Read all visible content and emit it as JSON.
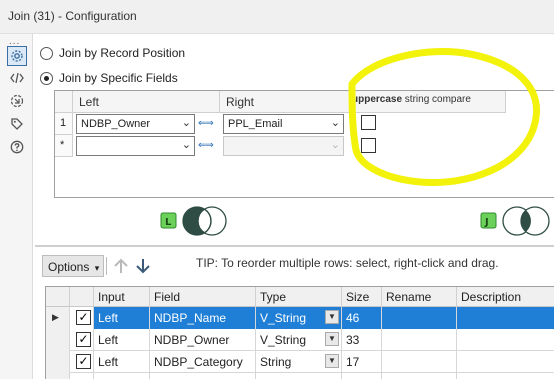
{
  "window": {
    "title": "Join (31) - Configuration"
  },
  "rail": {
    "dots": "...",
    "icons": [
      "gear-icon",
      "code-icon",
      "workflow-icon",
      "tag-icon",
      "help-icon"
    ]
  },
  "join_mode": {
    "options": [
      {
        "label": "Join by Record Position",
        "selected": false
      },
      {
        "label": "Join by Specific Fields",
        "selected": true
      }
    ]
  },
  "fields_grid": {
    "left_header": "Left",
    "right_header": "Right",
    "compare_header": "uppercase string compare",
    "compare_header_bold": "uppercase",
    "compare_header_rest": " string compare",
    "rows": [
      {
        "num": "1",
        "left": "NDBP_Owner",
        "right": "PPL_Email",
        "checked": false
      },
      {
        "num": "*",
        "left": "",
        "right": "",
        "checked": false
      }
    ]
  },
  "annotation": {
    "color": "#f2f20a"
  },
  "venn": {
    "left_badge": "L",
    "join_badge": "J",
    "badge_color": "#6cd15a"
  },
  "options_bar": {
    "options_label": "Options",
    "options_caret": "▾",
    "tip": "TIP: To reorder multiple rows: select, right-click and drag."
  },
  "field_table": {
    "headers": [
      "Input",
      "Field",
      "Type",
      "Size",
      "Rename",
      "Description"
    ],
    "rows": [
      {
        "input": "Left",
        "field": "NDBP_Name",
        "type": "V_String",
        "size": "46",
        "rename": "",
        "description": "",
        "checked": true,
        "selected": true
      },
      {
        "input": "Left",
        "field": "NDBP_Owner",
        "type": "V_String",
        "size": "33",
        "rename": "",
        "description": "",
        "checked": true,
        "selected": false
      },
      {
        "input": "Left",
        "field": "NDBP_Category",
        "type": "String",
        "size": "17",
        "rename": "",
        "description": "",
        "checked": true,
        "selected": false
      }
    ],
    "selected_color": "#1f7fd6"
  }
}
